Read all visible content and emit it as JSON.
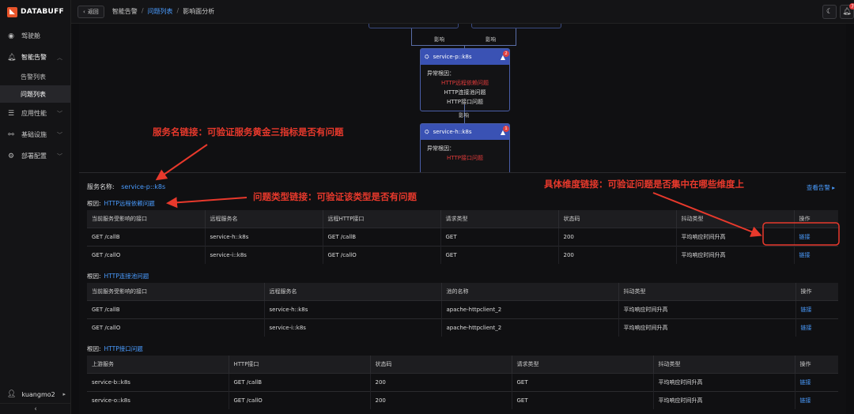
{
  "app": {
    "logo_text": "DATABUFF"
  },
  "sidebar": {
    "items": [
      {
        "label": "驾驶舱",
        "icon": "dashboard-icon"
      },
      {
        "label": "智能告警",
        "icon": "bell-icon"
      },
      {
        "label": "应用性能",
        "icon": "app-performance-icon"
      },
      {
        "label": "基础设施",
        "icon": "infrastructure-icon"
      },
      {
        "label": "部署配置",
        "icon": "gear-icon"
      }
    ],
    "sub_items": [
      "告警列表",
      "问题列表"
    ],
    "user": "kuangmo2"
  },
  "header": {
    "back_label": "返回",
    "crumb1": "智能告警",
    "crumb2": "问题列表",
    "crumb3": "影响面分析",
    "bell_count": "7"
  },
  "graph": {
    "edge_label": "影响",
    "node_p": {
      "name": "service-p::k8s",
      "badge": "2",
      "body_title": "异常根因：",
      "causes": [
        "HTTP远程依赖问题",
        "HTTP连接池问题",
        "HTTP接口问题"
      ]
    },
    "node_h": {
      "name": "service-h::k8s",
      "badge": "1",
      "body_title": "异常根因：",
      "causes": [
        "HTTP接口问题"
      ]
    }
  },
  "annotations": {
    "a1": "服务名链接：可验证服务黄金三指标是否有问题",
    "a2": "问题类型链接：可验证该类型是否有问题",
    "a3": "具体维度链接：可验证问题是否集中在哪些维度上"
  },
  "detail": {
    "service_label": "服务名称:",
    "service_name": "service-p::k8s",
    "view_alerts": "查看告警 ▸",
    "root_prefix": "根因:",
    "tables": [
      {
        "root": "HTTP远程依赖问题",
        "headers": [
          "当前服务受影响的接口",
          "远程服务名",
          "远程HTTP接口",
          "请求类型",
          "状态码",
          "抖动类型",
          "操作"
        ],
        "rows": [
          [
            "GET /callB",
            "service-h::k8s",
            "GET /callB",
            "GET",
            "200",
            "平均响应时间升高",
            "链接"
          ],
          [
            "GET /callO",
            "service-i::k8s",
            "GET /callO",
            "GET",
            "200",
            "平均响应时间升高",
            "链接"
          ]
        ]
      },
      {
        "root": "HTTP连接池问题",
        "headers": [
          "当前服务受影响的接口",
          "远程服务名",
          "池的名称",
          "抖动类型",
          "操作"
        ],
        "rows": [
          [
            "GET /callB",
            "service-h::k8s",
            "apache-httpclient_2",
            "平均响应时间升高",
            "链接"
          ],
          [
            "GET /callO",
            "service-i::k8s",
            "apache-httpclient_2",
            "平均响应时间升高",
            "链接"
          ]
        ]
      },
      {
        "root": "HTTP接口问题",
        "headers": [
          "上游服务",
          "HTTP接口",
          "状态码",
          "请求类型",
          "抖动类型",
          "操作"
        ],
        "rows": [
          [
            "service-b::k8s",
            "GET /callB",
            "200",
            "GET",
            "平均响应时间升高",
            "链接"
          ],
          [
            "service-o::k8s",
            "GET /callO",
            "200",
            "GET",
            "平均响应时间升高",
            "链接"
          ]
        ]
      }
    ]
  }
}
